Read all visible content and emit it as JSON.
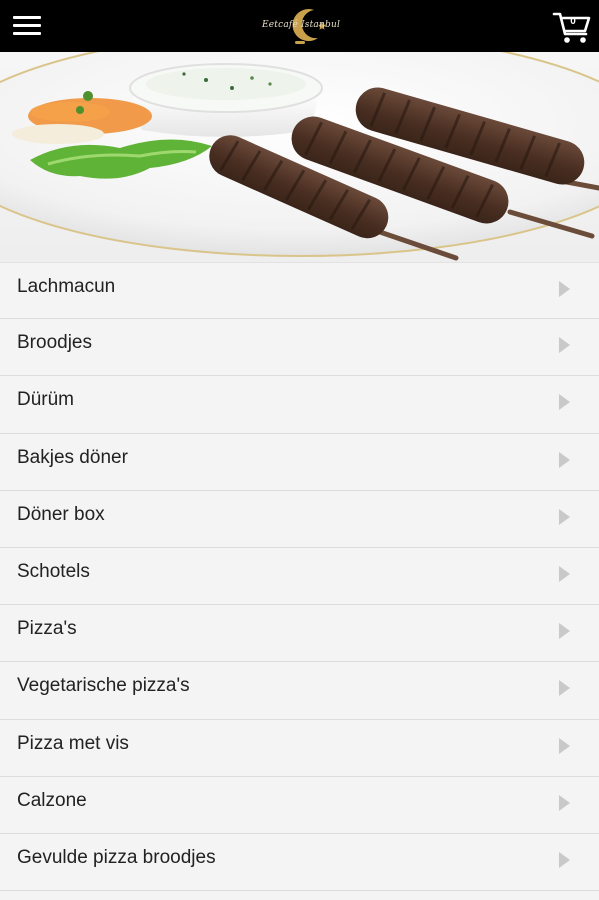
{
  "header": {
    "logo_text": "Eetcafé Istanbul",
    "menu_icon": "hamburger-menu-icon",
    "cart_icon": "shopping-cart-icon",
    "cart_count": "0",
    "background_color": "#000000"
  },
  "hero": {
    "image_description_icon": "kebab-plate-image"
  },
  "categories": [
    {
      "label": "Lachmacun",
      "icon": "chevron-right-icon"
    },
    {
      "label": "Broodjes",
      "icon": "chevron-right-icon"
    },
    {
      "label": "Dürüm",
      "icon": "chevron-right-icon"
    },
    {
      "label": "Bakjes döner",
      "icon": "chevron-right-icon"
    },
    {
      "label": "Döner box",
      "icon": "chevron-right-icon"
    },
    {
      "label": "Schotels",
      "icon": "chevron-right-icon"
    },
    {
      "label": "Pizza's",
      "icon": "chevron-right-icon"
    },
    {
      "label": "Vegetarische pizza's",
      "icon": "chevron-right-icon"
    },
    {
      "label": "Pizza met vis",
      "icon": "chevron-right-icon"
    },
    {
      "label": "Calzone",
      "icon": "chevron-right-icon"
    },
    {
      "label": "Gevulde pizza broodjes",
      "icon": "chevron-right-icon"
    }
  ],
  "colors": {
    "list_background": "#f4f4f4",
    "divider": "#dcdcdc",
    "label_text": "#222222",
    "chevron": "#c9c9c9",
    "logo_gold": "#c9a14a"
  }
}
